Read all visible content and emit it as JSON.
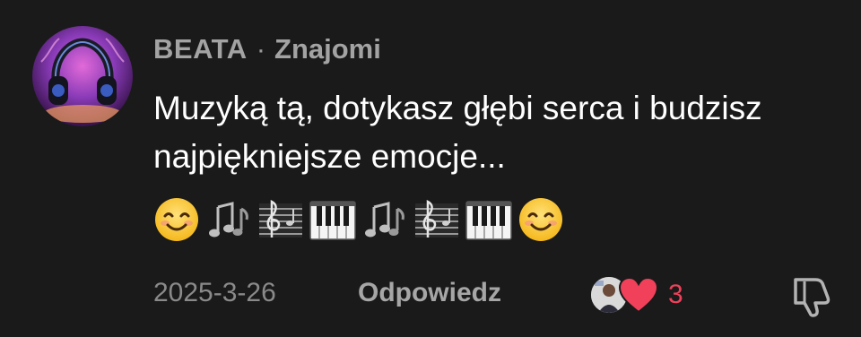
{
  "comment": {
    "author": "BEATA",
    "separator": "·",
    "relation": "Znajomi",
    "text": "Muzyką tą, dotykasz głębi serca i budzisz najpiękniejsze emocje...",
    "emojis": [
      "smiling-face",
      "musical-notes",
      "musical-score",
      "musical-keyboard",
      "musical-notes",
      "musical-score",
      "musical-keyboard",
      "smiling-face"
    ],
    "date": "2025-3-26",
    "reply_label": "Odpowiedz",
    "like_count": "3"
  },
  "colors": {
    "background": "#1a1a1a",
    "meta_text": "#9a9a9a",
    "like_accent": "#f0405a"
  },
  "icons": {
    "like": "heart-icon",
    "dislike": "thumbs-down-icon"
  }
}
